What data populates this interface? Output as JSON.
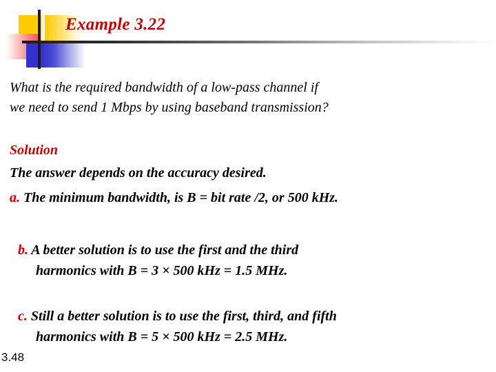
{
  "slide": {
    "title": "Example 3.22",
    "page_number": "3.48",
    "accent_color": "#C00000",
    "text_color": "#000000",
    "background_color": "#FFFFFF"
  },
  "decoration": {
    "name": "powerpoint-header-ornament",
    "yellow": "#FFCC00",
    "red": "#F25C5C",
    "blue": "#3333CC",
    "rule": "#1C1C1C"
  },
  "question": {
    "line1": "What is the required bandwidth of a low-pass channel if",
    "line2": "we need to send 1 Mbps by using baseband transmission?"
  },
  "solution": {
    "heading": "Solution",
    "intro": "The answer depends on the accuracy desired.",
    "items": [
      {
        "marker": "a.",
        "line1": " The minimum bandwidth, is B = bit rate /2, or 500 kHz.",
        "line2": ""
      },
      {
        "marker": "b.",
        "line1": " A better solution is to use the first and the third",
        "line2": "harmonics with  B = 3 × 500 kHz = 1.5 MHz."
      },
      {
        "marker": "c.",
        "line1": " Still a better solution is to use the first, third, and fifth",
        "line2": "harmonics with B = 5 × 500 kHz = 2.5 MHz."
      }
    ]
  }
}
